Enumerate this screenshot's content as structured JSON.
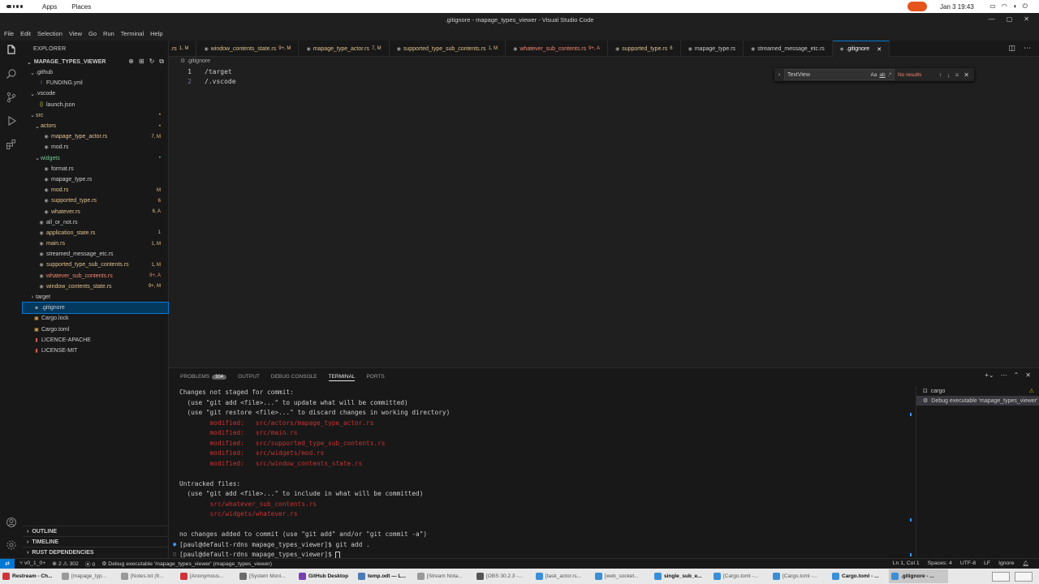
{
  "gnome": {
    "apps": "Apps",
    "places": "Places",
    "window_title": ".gitignore - mapage_types_viewer - Visual Studio Code",
    "clock": "Jan 3  19:43"
  },
  "menu": [
    "File",
    "Edit",
    "Selection",
    "View",
    "Go",
    "Run",
    "Terminal",
    "Help"
  ],
  "explorer": {
    "header": "EXPLORER",
    "project": "MAPAGE_TYPES_VIEWER",
    "tree": [
      {
        "label": ".github",
        "depth": 0,
        "kind": "folder",
        "open": true,
        "color": "normal",
        "badge": ""
      },
      {
        "label": "FUNDING.yml",
        "depth": 1,
        "kind": "yml",
        "color": "normal",
        "badge": ""
      },
      {
        "label": ".vscode",
        "depth": 0,
        "kind": "folder",
        "open": true,
        "color": "normal",
        "badge": ""
      },
      {
        "label": "launch.json",
        "depth": 1,
        "kind": "json",
        "color": "normal",
        "badge": ""
      },
      {
        "label": "src",
        "depth": 0,
        "kind": "folder",
        "open": true,
        "color": "mod",
        "badge": "•"
      },
      {
        "label": "actors",
        "depth": 1,
        "kind": "folder",
        "open": true,
        "color": "mod",
        "badge": "•"
      },
      {
        "label": "mapage_type_actor.rs",
        "depth": 2,
        "kind": "rs",
        "color": "mod",
        "badge": "7, M"
      },
      {
        "label": "mod.rs",
        "depth": 2,
        "kind": "rs",
        "color": "normal",
        "badge": ""
      },
      {
        "label": "widgets",
        "depth": 1,
        "kind": "folder",
        "open": true,
        "color": "untracked",
        "badge": "•"
      },
      {
        "label": "format.rs",
        "depth": 2,
        "kind": "rs",
        "color": "normal",
        "badge": ""
      },
      {
        "label": "mapage_type.rs",
        "depth": 2,
        "kind": "rs",
        "color": "normal",
        "badge": ""
      },
      {
        "label": "mod.rs",
        "depth": 2,
        "kind": "rs",
        "color": "mod",
        "badge": "M"
      },
      {
        "label": "supported_type.rs",
        "depth": 2,
        "kind": "rs",
        "color": "orange",
        "badge": "6"
      },
      {
        "label": "whatever.rs",
        "depth": 2,
        "kind": "rs",
        "color": "orange",
        "badge": "6, A"
      },
      {
        "label": "all_or_not.rs",
        "depth": 1,
        "kind": "rs",
        "color": "normal",
        "badge": ""
      },
      {
        "label": "application_state.rs",
        "depth": 1,
        "kind": "rs",
        "color": "orange",
        "badge": "1"
      },
      {
        "label": "main.rs",
        "depth": 1,
        "kind": "rs",
        "color": "mod",
        "badge": "1, M"
      },
      {
        "label": "streamed_message_etc.rs",
        "depth": 1,
        "kind": "rs",
        "color": "normal",
        "badge": ""
      },
      {
        "label": "supported_type_sub_contents.rs",
        "depth": 1,
        "kind": "rs",
        "color": "mod",
        "badge": "1, M"
      },
      {
        "label": "whatever_sub_contents.rs",
        "depth": 1,
        "kind": "rs",
        "color": "red",
        "badge": "9+, A"
      },
      {
        "label": "window_contents_state.rs",
        "depth": 1,
        "kind": "rs",
        "color": "mod",
        "badge": "9+, M"
      },
      {
        "label": "target",
        "depth": 0,
        "kind": "folder",
        "open": false,
        "color": "normal",
        "badge": ""
      },
      {
        "label": ".gitignore",
        "depth": 0,
        "kind": "git",
        "color": "normal",
        "badge": "",
        "selected": true
      },
      {
        "label": "Cargo.lock",
        "depth": 0,
        "kind": "cargo",
        "color": "normal",
        "badge": ""
      },
      {
        "label": "Cargo.toml",
        "depth": 0,
        "kind": "cargo",
        "color": "normal",
        "badge": ""
      },
      {
        "label": "LICENCE-APACHE",
        "depth": 0,
        "kind": "license",
        "color": "normal",
        "badge": ""
      },
      {
        "label": "LICENSE-MIT",
        "depth": 0,
        "kind": "license",
        "color": "normal",
        "badge": ""
      }
    ],
    "outline": "OUTLINE",
    "timeline": "TIMELINE",
    "rust_deps": "RUST DEPENDENCIES"
  },
  "tabs": [
    {
      "label": ".rs",
      "badge": "1, M",
      "color": "mod"
    },
    {
      "label": "window_contents_state.rs",
      "badge": "9+, M",
      "color": "mod"
    },
    {
      "label": "mapage_type_actor.rs",
      "badge": "7, M",
      "color": "mod"
    },
    {
      "label": "supported_type_sub_contents.rs",
      "badge": "1, M",
      "color": "mod"
    },
    {
      "label": "whatever_sub_contents.rs",
      "badge": "9+, A",
      "color": "red"
    },
    {
      "label": "supported_type.rs",
      "badge": "6",
      "color": "orange"
    },
    {
      "label": "mapage_type.rs",
      "badge": "",
      "color": "normal"
    },
    {
      "label": "streamed_message_etc.rs",
      "badge": "",
      "color": "normal"
    },
    {
      "label": ".gitignore",
      "badge": "",
      "color": "normal",
      "active": true
    }
  ],
  "editor": {
    "breadcrumb": ".gitignore",
    "lines": [
      {
        "n": "1",
        "text": "/target"
      },
      {
        "n": "2",
        "text": "/.vscode"
      }
    ]
  },
  "find": {
    "value": "TextView",
    "case": "Aa",
    "word": "ab",
    "regex": ".*",
    "result": "No results"
  },
  "panel": {
    "tabs": [
      {
        "label": "PROBLEMS",
        "count": "304"
      },
      {
        "label": "OUTPUT",
        "count": ""
      },
      {
        "label": "DEBUG CONSOLE",
        "count": ""
      },
      {
        "label": "TERMINAL",
        "count": "",
        "active": true
      },
      {
        "label": "PORTS",
        "count": ""
      }
    ],
    "terminal_lines": [
      {
        "text": "Changes not staged for commit:",
        "style": "normal"
      },
      {
        "text": "  (use \"git add <file>...\" to update what will be committed)",
        "style": "normal"
      },
      {
        "text": "  (use \"git restore <file>...\" to discard changes in working directory)",
        "style": "normal"
      },
      {
        "text": "        modified:   src/actors/mapage_type_actor.rs",
        "style": "red"
      },
      {
        "text": "        modified:   src/main.rs",
        "style": "red"
      },
      {
        "text": "        modified:   src/supported_type_sub_contents.rs",
        "style": "red"
      },
      {
        "text": "        modified:   src/widgets/mod.rs",
        "style": "red"
      },
      {
        "text": "        modified:   src/window_contents_state.rs",
        "style": "red"
      },
      {
        "text": "",
        "style": "normal"
      },
      {
        "text": "Untracked files:",
        "style": "normal"
      },
      {
        "text": "  (use \"git add <file>...\" to include in what will be committed)",
        "style": "normal"
      },
      {
        "text": "        src/whatever_sub_contents.rs",
        "style": "red"
      },
      {
        "text": "        src/widgets/whatever.rs",
        "style": "red"
      },
      {
        "text": "",
        "style": "normal"
      },
      {
        "text": "no changes added to commit (use \"git add\" and/or \"git commit -a\")",
        "style": "normal"
      },
      {
        "text": "[paul@default-rdns mapage_types_viewer]$ git add .",
        "style": "prompt-done"
      },
      {
        "text": "[paul@default-rdns mapage_types_viewer]$ ",
        "style": "prompt-current"
      }
    ],
    "terminal_list": [
      {
        "label": "cargo",
        "selected": false
      },
      {
        "label": "Debug executable 'mapage_types_viewer'",
        "selected": true
      }
    ]
  },
  "status": {
    "branch": "v0_1_0+",
    "errors": "2",
    "warnings": "302",
    "ports": "0",
    "debug": "Debug executable 'mapage_types_viewer' (mapage_types_viewer)",
    "position": "Ln 1, Col 1",
    "spaces": "Spaces: 4",
    "encoding": "UTF-8",
    "eol": "LF",
    "language": "Ignore"
  },
  "taskbar": [
    {
      "label": "Restream - Ch...",
      "color": "#d0343a",
      "bold": true
    },
    {
      "label": "[mapage_typ...",
      "color": "#9a9a9a"
    },
    {
      "label": "[Notes.txt (fr...",
      "color": "#9a9a9a"
    },
    {
      "label": "[Anonymous...",
      "color": "#d0343a"
    },
    {
      "label": "[System Moni...",
      "color": "#6b6b6b"
    },
    {
      "label": "GitHub Desktop",
      "color": "#7b3fb3",
      "bold": true
    },
    {
      "label": "temp.odt — L...",
      "color": "#4a7ab8",
      "bold": true
    },
    {
      "label": "[Stream Nota...",
      "color": "#9a9a9a"
    },
    {
      "label": "[OBS 30.2.3 -...",
      "color": "#555555"
    },
    {
      "label": "[task_actor.rs...",
      "color": "#3a8fd8"
    },
    {
      "label": "[web_socket...",
      "color": "#3a8fd8"
    },
    {
      "label": "single_sub_e...",
      "color": "#3a8fd8",
      "bold": true
    },
    {
      "label": "[Cargo.toml -...",
      "color": "#3a8fd8"
    },
    {
      "label": "[Cargo.toml -...",
      "color": "#3a8fd8"
    },
    {
      "label": "Cargo.toml - ...",
      "color": "#3a8fd8",
      "bold": true
    },
    {
      "label": ".gitignore - ...",
      "color": "#3a8fd8",
      "bold": true,
      "active": true
    }
  ]
}
